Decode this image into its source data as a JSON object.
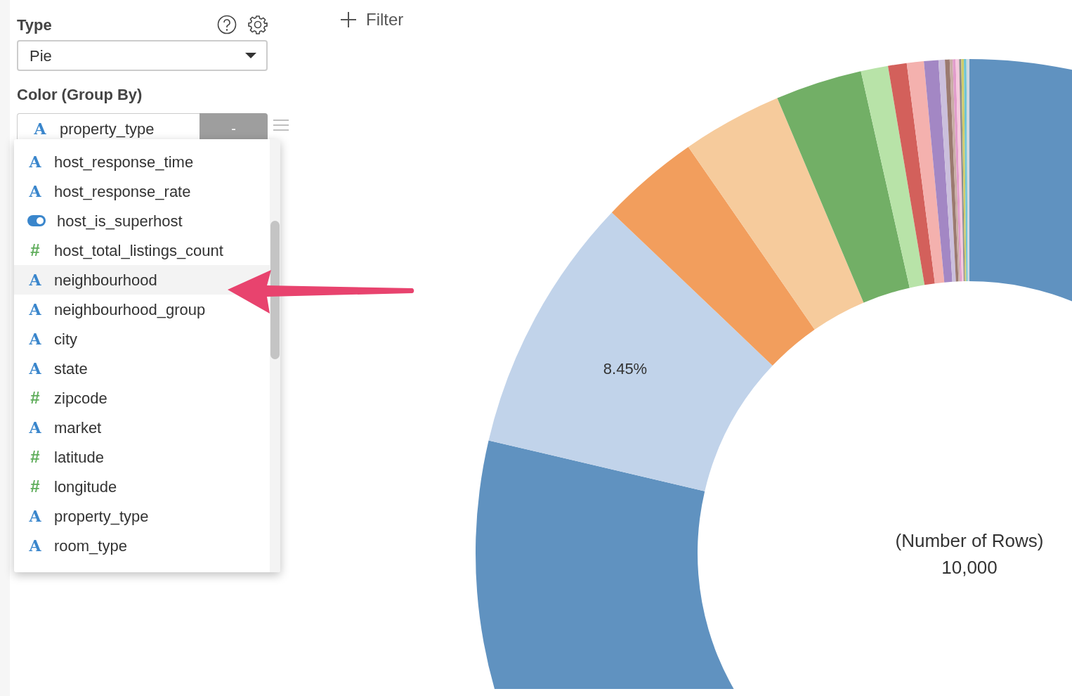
{
  "type_field": {
    "label": "Type",
    "value": "Pie"
  },
  "filter_button": {
    "label": "Filter"
  },
  "color_group_by": {
    "label": "Color (Group By)",
    "column": {
      "kind": "string",
      "icon": "A",
      "name": "property_type"
    },
    "remove_label": "-"
  },
  "column_menu": {
    "items": [
      {
        "kind": "string",
        "icon": "A",
        "name": "host_response_time",
        "highlighted": false
      },
      {
        "kind": "string",
        "icon": "A",
        "name": "host_response_rate",
        "highlighted": false
      },
      {
        "kind": "boolean",
        "name": "host_is_superhost",
        "highlighted": false
      },
      {
        "kind": "number",
        "icon": "#",
        "name": "host_total_listings_count",
        "highlighted": false
      },
      {
        "kind": "string",
        "icon": "A",
        "name": "neighbourhood",
        "highlighted": true
      },
      {
        "kind": "string",
        "icon": "A",
        "name": "neighbourhood_group",
        "highlighted": false
      },
      {
        "kind": "string",
        "icon": "A",
        "name": "city",
        "highlighted": false
      },
      {
        "kind": "string",
        "icon": "A",
        "name": "state",
        "highlighted": false
      },
      {
        "kind": "number",
        "icon": "#",
        "name": "zipcode",
        "highlighted": false
      },
      {
        "kind": "string",
        "icon": "A",
        "name": "market",
        "highlighted": false
      },
      {
        "kind": "number",
        "icon": "#",
        "name": "latitude",
        "highlighted": false
      },
      {
        "kind": "number",
        "icon": "#",
        "name": "longitude",
        "highlighted": false
      },
      {
        "kind": "string",
        "icon": "A",
        "name": "property_type",
        "highlighted": false
      },
      {
        "kind": "string",
        "icon": "A",
        "name": "room_type",
        "highlighted": false
      }
    ]
  },
  "chart": {
    "slice_label": "8.45%",
    "center_label": "(Number of Rows)",
    "center_value": "10,000"
  }
}
